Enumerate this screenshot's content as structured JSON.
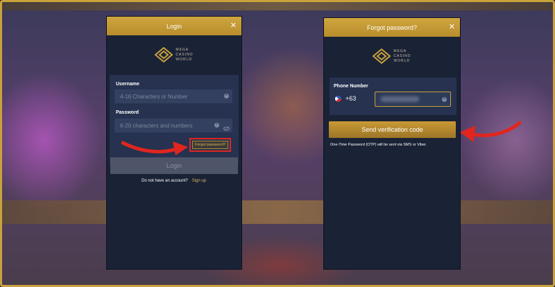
{
  "login": {
    "title": "Login",
    "logo_lines": [
      "MEGA",
      "CASINO",
      "WORLD"
    ],
    "username_label": "Username",
    "username_placeholder": "4-16 Characters or Number",
    "password_label": "Password",
    "password_placeholder": "6-20 characters and numbers",
    "forgot_label": "Forgot password?",
    "login_button": "Login",
    "no_account_text": "Do not have an account?",
    "signup_link": "Sign up"
  },
  "forgot": {
    "title": "Forgot password?",
    "logo_lines": [
      "MEGA",
      "CASINO",
      "WORLD"
    ],
    "phone_label": "Phone Number",
    "country_code": "+63",
    "phone_value": "",
    "send_button": "Send verification code",
    "otp_note": "One-Time Password (OTP) will be sent via SMS or Viber."
  },
  "colors": {
    "accent_gold": "#c9a23c",
    "panel_bg": "#1a2236",
    "highlight_red": "#e0261f"
  }
}
